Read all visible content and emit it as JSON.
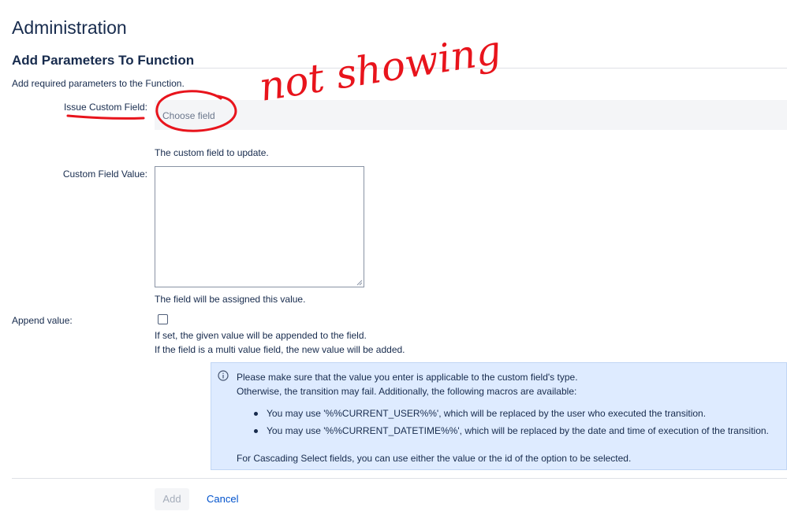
{
  "header": {
    "title": "Administration"
  },
  "section": {
    "title": "Add Parameters To Function",
    "intro": "Add required parameters to the Function."
  },
  "fields": {
    "issue_custom_field": {
      "label": "Issue Custom Field:",
      "placeholder": "Choose field",
      "description": "The custom field to update."
    },
    "custom_field_value": {
      "label": "Custom Field Value:",
      "value": "",
      "description": "The field will be assigned this value."
    },
    "append_value": {
      "label": "Append value:",
      "checked": false,
      "description_1": "If set, the given value will be appended to the field.",
      "description_2": "If the field is a multi value field, the new value will be added."
    }
  },
  "info": {
    "icon": "info-icon",
    "line_1": "Please make sure that the value you enter is applicable to the custom field's type.",
    "line_2": "Otherwise, the transition may fail. Additionally, the following macros are available:",
    "bullets": [
      "You may use '%%CURRENT_USER%%', which will be replaced by the user who executed the transition.",
      "You may use '%%CURRENT_DATETIME%%', which will be replaced by the date and time of execution of the transition."
    ],
    "footer": "For Cascading Select fields, you can use either the value or the id of the option to be selected."
  },
  "buttons": {
    "add": "Add",
    "cancel": "Cancel"
  },
  "annotation": {
    "text": "not showing",
    "color": "#e8141c"
  },
  "colors": {
    "link": "#0052cc",
    "info_bg": "#deebff",
    "text": "#172b4d"
  }
}
